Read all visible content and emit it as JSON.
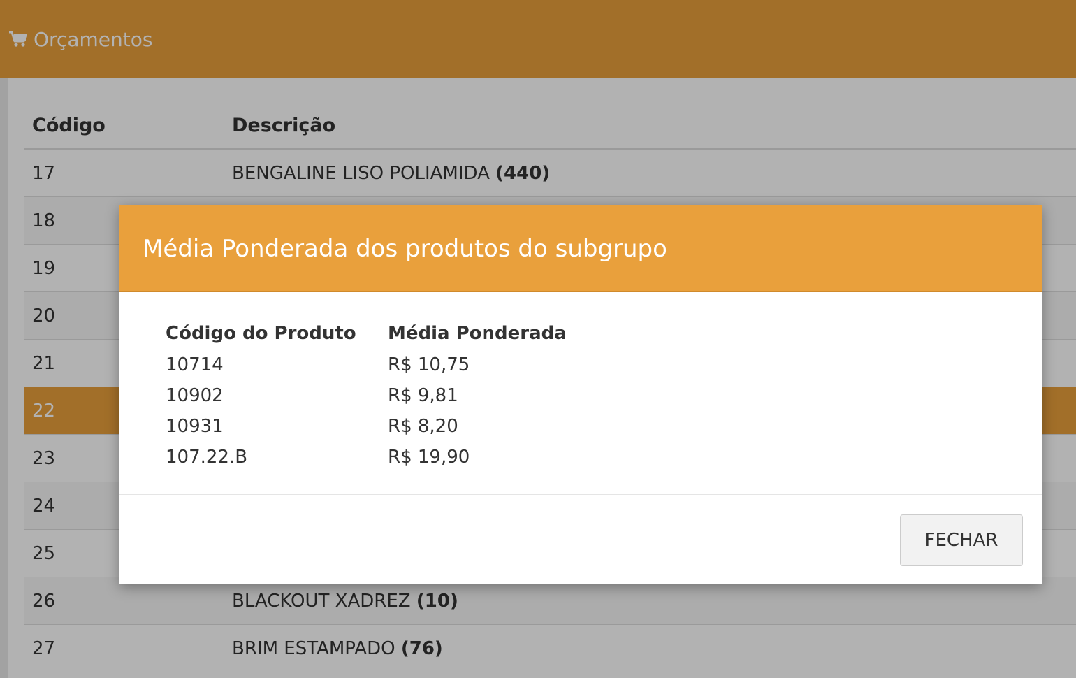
{
  "header": {
    "title": "Orçamentos",
    "icon": "cart-icon",
    "accent_color": "#e9a03c"
  },
  "table": {
    "columns": [
      "Código",
      "Descrição"
    ],
    "rows": [
      {
        "code": "17",
        "description": "BENGALINE LISO POLIAMIDA",
        "count": "(440)"
      },
      {
        "code": "18",
        "description": "",
        "count": ""
      },
      {
        "code": "19",
        "description": "",
        "count": ""
      },
      {
        "code": "20",
        "description": "",
        "count": ""
      },
      {
        "code": "21",
        "description": "",
        "count": ""
      },
      {
        "code": "22",
        "description": "",
        "count": "",
        "selected": true
      },
      {
        "code": "23",
        "description": "",
        "count": ""
      },
      {
        "code": "24",
        "description": "",
        "count": ""
      },
      {
        "code": "25",
        "description": "",
        "count": ""
      },
      {
        "code": "26",
        "description": "BLACKOUT XADREZ",
        "count": "(10)"
      },
      {
        "code": "27",
        "description": "BRIM ESTAMPADO",
        "count": "(76)"
      }
    ]
  },
  "modal": {
    "title": "Média Ponderada dos produtos do subgrupo",
    "columns": [
      "Código do Produto",
      "Média Ponderada"
    ],
    "rows": [
      {
        "code": "10714",
        "average": "R$ 10,75"
      },
      {
        "code": "10902",
        "average": "R$ 9,81"
      },
      {
        "code": "10931",
        "average": "R$ 8,20"
      },
      {
        "code": "107.22.B",
        "average": "R$ 19,90"
      }
    ],
    "close_label": "FECHAR"
  }
}
